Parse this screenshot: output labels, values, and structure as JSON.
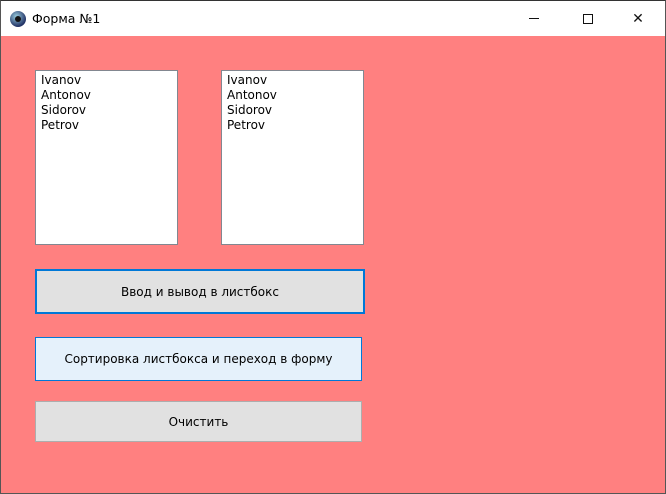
{
  "window": {
    "title": "Форма №1",
    "minimize": "minimize",
    "maximize": "maximize",
    "close": "✕"
  },
  "listbox1": {
    "items": [
      "Ivanov",
      "Antonov",
      "Sidorov",
      "Petrov"
    ]
  },
  "listbox2": {
    "items": [
      "Ivanov",
      "Antonov",
      "Sidorov",
      "Petrov"
    ]
  },
  "buttons": {
    "input_output": "Ввод и вывод в листбокс",
    "sort_go": "Сортировка листбокса и переход в форму",
    "clear": "Очистить"
  },
  "colors": {
    "form_bg": "#ff8080",
    "accent": "#0078d7"
  }
}
